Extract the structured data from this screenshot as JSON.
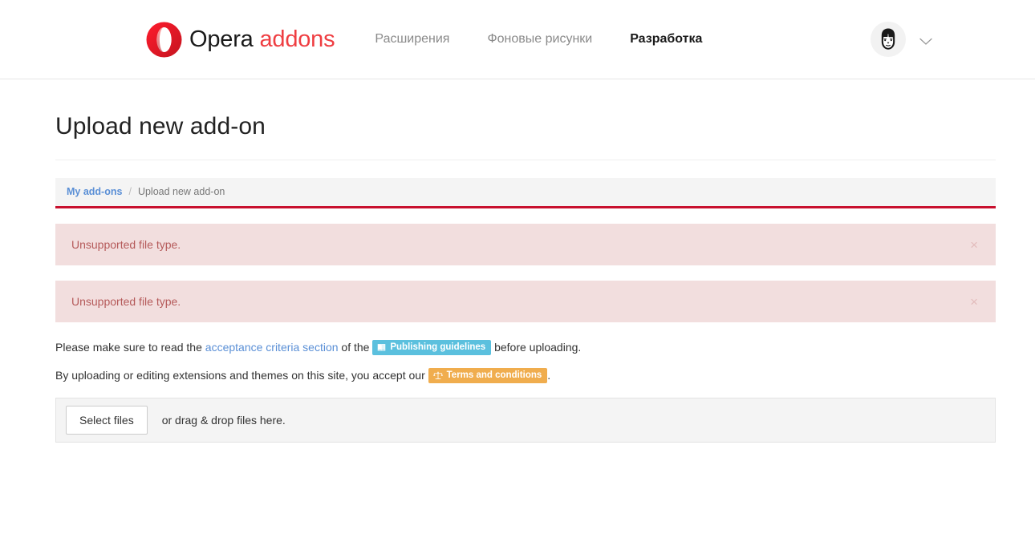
{
  "header": {
    "brand": {
      "logo_icon": "opera-o-logo",
      "name_primary": "Opera",
      "name_secondary": "addons"
    },
    "nav": [
      {
        "label": "Расширения",
        "active": false
      },
      {
        "label": "Фоновые рисунки",
        "active": false
      },
      {
        "label": "Разработка",
        "active": true
      }
    ],
    "user": {
      "avatar_icon": "user-avatar-face",
      "caret_icon": "chevron-down-icon"
    }
  },
  "page": {
    "title": "Upload new add-on"
  },
  "breadcrumb": {
    "parent_label": "My add-ons",
    "separator": "/",
    "current_label": "Upload new add-on",
    "accent_color": "#c8102e"
  },
  "alerts": [
    {
      "message": "Unsupported file type.",
      "close_label": "×"
    },
    {
      "message": "Unsupported file type.",
      "close_label": "×"
    }
  ],
  "info": {
    "line1_part1": "Please make sure to read the ",
    "line1_link": "acceptance criteria section",
    "line1_part2": " of the ",
    "line1_badge": "Publishing guidelines",
    "line1_badge_icon": "book-icon",
    "line1_badge_color": "#5bc0de",
    "line1_part3": " before uploading.",
    "line2_part1": "By uploading or editing extensions and themes on this site, you accept our ",
    "line2_badge": "Terms and conditions",
    "line2_badge_icon": "scales-icon",
    "line2_badge_color": "#f0ad4e",
    "line2_part2": "."
  },
  "upload": {
    "select_button": "Select files",
    "drag_drop_hint": "or drag & drop files here."
  }
}
